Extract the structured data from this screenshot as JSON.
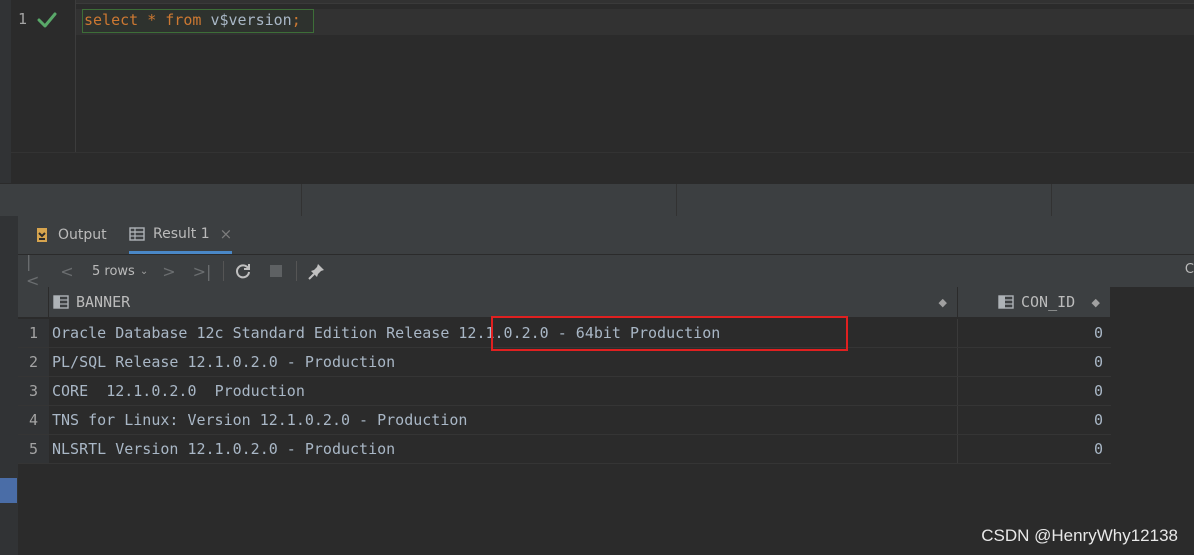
{
  "editor": {
    "line_number": "1",
    "code": {
      "kw_select": "select",
      "op_star": "*",
      "kw_from": "from",
      "table": "v$version",
      "semicolon": ";"
    }
  },
  "tabs": [
    {
      "label": "Output"
    },
    {
      "label": "Result 1",
      "close": "×"
    }
  ],
  "toolbar": {
    "first": "|<",
    "prev": "<",
    "rows_label": "5 rows",
    "rows_chevron": "⌄",
    "next": ">",
    "last": ">|",
    "edge_char": "C"
  },
  "grid": {
    "columns": [
      {
        "name": "BANNER",
        "sort": "◆"
      },
      {
        "name": "CON_ID",
        "sort": "◆"
      }
    ],
    "rows": [
      {
        "num": "1",
        "banner": "Oracle Database 12c Standard Edition Release 12.1.0.2.0 - 64bit Production",
        "con_id": "0"
      },
      {
        "num": "2",
        "banner": "PL/SQL Release 12.1.0.2.0 - Production",
        "con_id": "0"
      },
      {
        "num": "3",
        "banner": "CORE\t12.1.0.2.0\tProduction",
        "con_id": "0"
      },
      {
        "num": "4",
        "banner": "TNS for Linux: Version 12.1.0.2.0 - Production",
        "con_id": "0"
      },
      {
        "num": "5",
        "banner": "NLSRTL Version 12.1.0.2.0 - Production",
        "con_id": "0"
      }
    ]
  },
  "watermark": "CSDN @HenryWhy12138",
  "colors": {
    "accent": "#4a88c7",
    "highlight": "#e02020",
    "check": "#59a869",
    "keyword": "#cc7832"
  }
}
